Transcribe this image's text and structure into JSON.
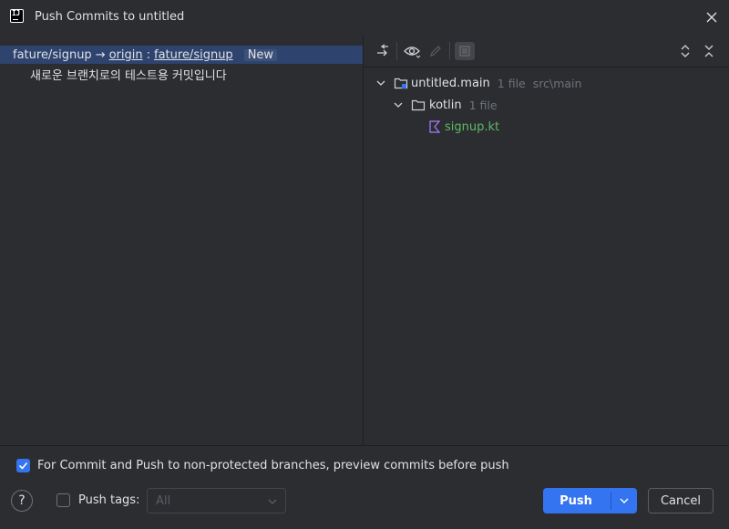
{
  "window": {
    "title": "Push Commits to untitled"
  },
  "commit_list": {
    "branch_local": "fature/signup",
    "arrow": "→",
    "remote": "origin",
    "separator": ":",
    "branch_remote": "fature/signup",
    "badge": "New",
    "commits": [
      {
        "message": "새로운 브랜치로의 테스트용 커밋입니다"
      }
    ]
  },
  "file_tree": {
    "module": {
      "name": "untitled.main",
      "count": "1 file",
      "path": "src\\main"
    },
    "folder": {
      "name": "kotlin",
      "count": "1 file"
    },
    "file": {
      "name": "signup.kt"
    }
  },
  "options": {
    "preview_label": "For Commit and Push to non-protected branches, preview commits before push",
    "preview_checked": true,
    "push_tags_label": "Push tags:",
    "push_tags_checked": false,
    "push_tags_value": "All"
  },
  "buttons": {
    "help": "?",
    "push": "Push",
    "cancel": "Cancel"
  },
  "colors": {
    "accent": "#3574f0",
    "selection": "#2e436e",
    "file_green": "#5fb865",
    "kotlin_purple": "#a97bff"
  }
}
